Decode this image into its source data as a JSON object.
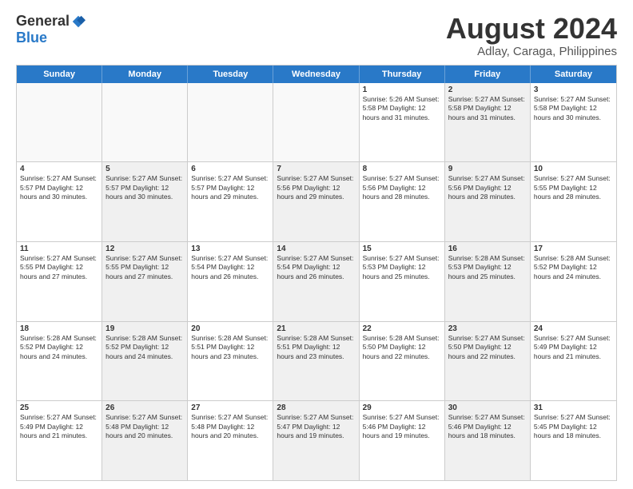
{
  "logo": {
    "general": "General",
    "blue": "Blue"
  },
  "title": "August 2024",
  "subtitle": "Adlay, Caraga, Philippines",
  "header": {
    "days": [
      "Sunday",
      "Monday",
      "Tuesday",
      "Wednesday",
      "Thursday",
      "Friday",
      "Saturday"
    ]
  },
  "rows": [
    {
      "cells": [
        {
          "day": "",
          "content": "",
          "empty": true
        },
        {
          "day": "",
          "content": "",
          "empty": true
        },
        {
          "day": "",
          "content": "",
          "empty": true
        },
        {
          "day": "",
          "content": "",
          "empty": true
        },
        {
          "day": "1",
          "content": "Sunrise: 5:26 AM\nSunset: 5:58 PM\nDaylight: 12 hours\nand 31 minutes.",
          "shaded": false
        },
        {
          "day": "2",
          "content": "Sunrise: 5:27 AM\nSunset: 5:58 PM\nDaylight: 12 hours\nand 31 minutes.",
          "shaded": true
        },
        {
          "day": "3",
          "content": "Sunrise: 5:27 AM\nSunset: 5:58 PM\nDaylight: 12 hours\nand 30 minutes.",
          "shaded": false
        }
      ]
    },
    {
      "cells": [
        {
          "day": "4",
          "content": "Sunrise: 5:27 AM\nSunset: 5:57 PM\nDaylight: 12 hours\nand 30 minutes.",
          "shaded": false
        },
        {
          "day": "5",
          "content": "Sunrise: 5:27 AM\nSunset: 5:57 PM\nDaylight: 12 hours\nand 30 minutes.",
          "shaded": true
        },
        {
          "day": "6",
          "content": "Sunrise: 5:27 AM\nSunset: 5:57 PM\nDaylight: 12 hours\nand 29 minutes.",
          "shaded": false
        },
        {
          "day": "7",
          "content": "Sunrise: 5:27 AM\nSunset: 5:56 PM\nDaylight: 12 hours\nand 29 minutes.",
          "shaded": true
        },
        {
          "day": "8",
          "content": "Sunrise: 5:27 AM\nSunset: 5:56 PM\nDaylight: 12 hours\nand 28 minutes.",
          "shaded": false
        },
        {
          "day": "9",
          "content": "Sunrise: 5:27 AM\nSunset: 5:56 PM\nDaylight: 12 hours\nand 28 minutes.",
          "shaded": true
        },
        {
          "day": "10",
          "content": "Sunrise: 5:27 AM\nSunset: 5:55 PM\nDaylight: 12 hours\nand 28 minutes.",
          "shaded": false
        }
      ]
    },
    {
      "cells": [
        {
          "day": "11",
          "content": "Sunrise: 5:27 AM\nSunset: 5:55 PM\nDaylight: 12 hours\nand 27 minutes.",
          "shaded": false
        },
        {
          "day": "12",
          "content": "Sunrise: 5:27 AM\nSunset: 5:55 PM\nDaylight: 12 hours\nand 27 minutes.",
          "shaded": true
        },
        {
          "day": "13",
          "content": "Sunrise: 5:27 AM\nSunset: 5:54 PM\nDaylight: 12 hours\nand 26 minutes.",
          "shaded": false
        },
        {
          "day": "14",
          "content": "Sunrise: 5:27 AM\nSunset: 5:54 PM\nDaylight: 12 hours\nand 26 minutes.",
          "shaded": true
        },
        {
          "day": "15",
          "content": "Sunrise: 5:27 AM\nSunset: 5:53 PM\nDaylight: 12 hours\nand 25 minutes.",
          "shaded": false
        },
        {
          "day": "16",
          "content": "Sunrise: 5:28 AM\nSunset: 5:53 PM\nDaylight: 12 hours\nand 25 minutes.",
          "shaded": true
        },
        {
          "day": "17",
          "content": "Sunrise: 5:28 AM\nSunset: 5:52 PM\nDaylight: 12 hours\nand 24 minutes.",
          "shaded": false
        }
      ]
    },
    {
      "cells": [
        {
          "day": "18",
          "content": "Sunrise: 5:28 AM\nSunset: 5:52 PM\nDaylight: 12 hours\nand 24 minutes.",
          "shaded": false
        },
        {
          "day": "19",
          "content": "Sunrise: 5:28 AM\nSunset: 5:52 PM\nDaylight: 12 hours\nand 24 minutes.",
          "shaded": true
        },
        {
          "day": "20",
          "content": "Sunrise: 5:28 AM\nSunset: 5:51 PM\nDaylight: 12 hours\nand 23 minutes.",
          "shaded": false
        },
        {
          "day": "21",
          "content": "Sunrise: 5:28 AM\nSunset: 5:51 PM\nDaylight: 12 hours\nand 23 minutes.",
          "shaded": true
        },
        {
          "day": "22",
          "content": "Sunrise: 5:28 AM\nSunset: 5:50 PM\nDaylight: 12 hours\nand 22 minutes.",
          "shaded": false
        },
        {
          "day": "23",
          "content": "Sunrise: 5:27 AM\nSunset: 5:50 PM\nDaylight: 12 hours\nand 22 minutes.",
          "shaded": true
        },
        {
          "day": "24",
          "content": "Sunrise: 5:27 AM\nSunset: 5:49 PM\nDaylight: 12 hours\nand 21 minutes.",
          "shaded": false
        }
      ]
    },
    {
      "cells": [
        {
          "day": "25",
          "content": "Sunrise: 5:27 AM\nSunset: 5:49 PM\nDaylight: 12 hours\nand 21 minutes.",
          "shaded": false
        },
        {
          "day": "26",
          "content": "Sunrise: 5:27 AM\nSunset: 5:48 PM\nDaylight: 12 hours\nand 20 minutes.",
          "shaded": true
        },
        {
          "day": "27",
          "content": "Sunrise: 5:27 AM\nSunset: 5:48 PM\nDaylight: 12 hours\nand 20 minutes.",
          "shaded": false
        },
        {
          "day": "28",
          "content": "Sunrise: 5:27 AM\nSunset: 5:47 PM\nDaylight: 12 hours\nand 19 minutes.",
          "shaded": true
        },
        {
          "day": "29",
          "content": "Sunrise: 5:27 AM\nSunset: 5:46 PM\nDaylight: 12 hours\nand 19 minutes.",
          "shaded": false
        },
        {
          "day": "30",
          "content": "Sunrise: 5:27 AM\nSunset: 5:46 PM\nDaylight: 12 hours\nand 18 minutes.",
          "shaded": true
        },
        {
          "day": "31",
          "content": "Sunrise: 5:27 AM\nSunset: 5:45 PM\nDaylight: 12 hours\nand 18 minutes.",
          "shaded": false
        }
      ]
    }
  ]
}
